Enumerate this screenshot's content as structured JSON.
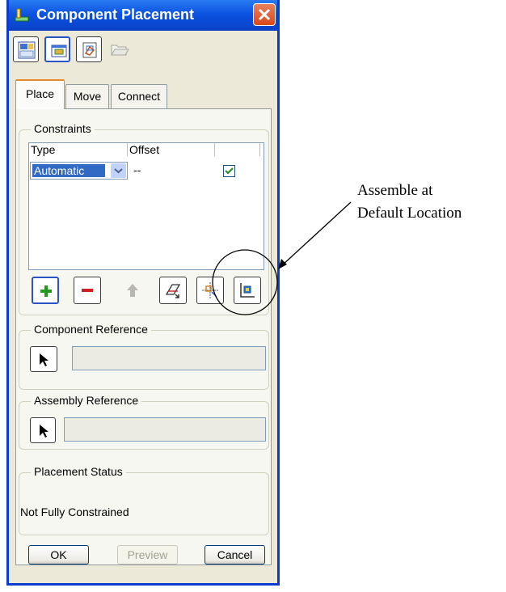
{
  "window": {
    "title": "Component Placement",
    "close_icon": "close-icon"
  },
  "toolbar": {
    "buttons": [
      {
        "icon": "placement-layout-icon"
      },
      {
        "icon": "component-window-icon"
      },
      {
        "icon": "package-icon"
      },
      {
        "icon": "open-folder-icon",
        "disabled": true
      }
    ]
  },
  "tabs": {
    "place": "Place",
    "move": "Move",
    "connect": "Connect",
    "active": "place"
  },
  "constraints": {
    "title": "Constraints",
    "columns": [
      "Type",
      "Offset",
      ""
    ],
    "rows": [
      {
        "type": "Automatic",
        "offset": "--",
        "checked": true
      }
    ],
    "actions": [
      {
        "icon": "add-icon"
      },
      {
        "icon": "remove-icon"
      },
      {
        "icon": "move-up-icon",
        "disabled": true
      },
      {
        "icon": "flip-constraint-icon"
      },
      {
        "icon": "assemble-icon"
      },
      {
        "icon": "default-location-icon"
      }
    ]
  },
  "component_reference": {
    "title": "Component Reference",
    "value": ""
  },
  "assembly_reference": {
    "title": "Assembly Reference",
    "value": ""
  },
  "placement_status": {
    "title": "Placement Status",
    "text": "Not Fully Constrained"
  },
  "footer": {
    "ok": "OK",
    "preview": "Preview",
    "cancel": "Cancel"
  },
  "annotation": {
    "line1": "Assemble at",
    "line2": "Default Location"
  },
  "colors": {
    "titlebar": "#0b53e0",
    "selection": "#316ac5",
    "add_green": "#1f9a1f",
    "remove_red": "#d01f1f",
    "check_green": "#2a8a2a"
  }
}
